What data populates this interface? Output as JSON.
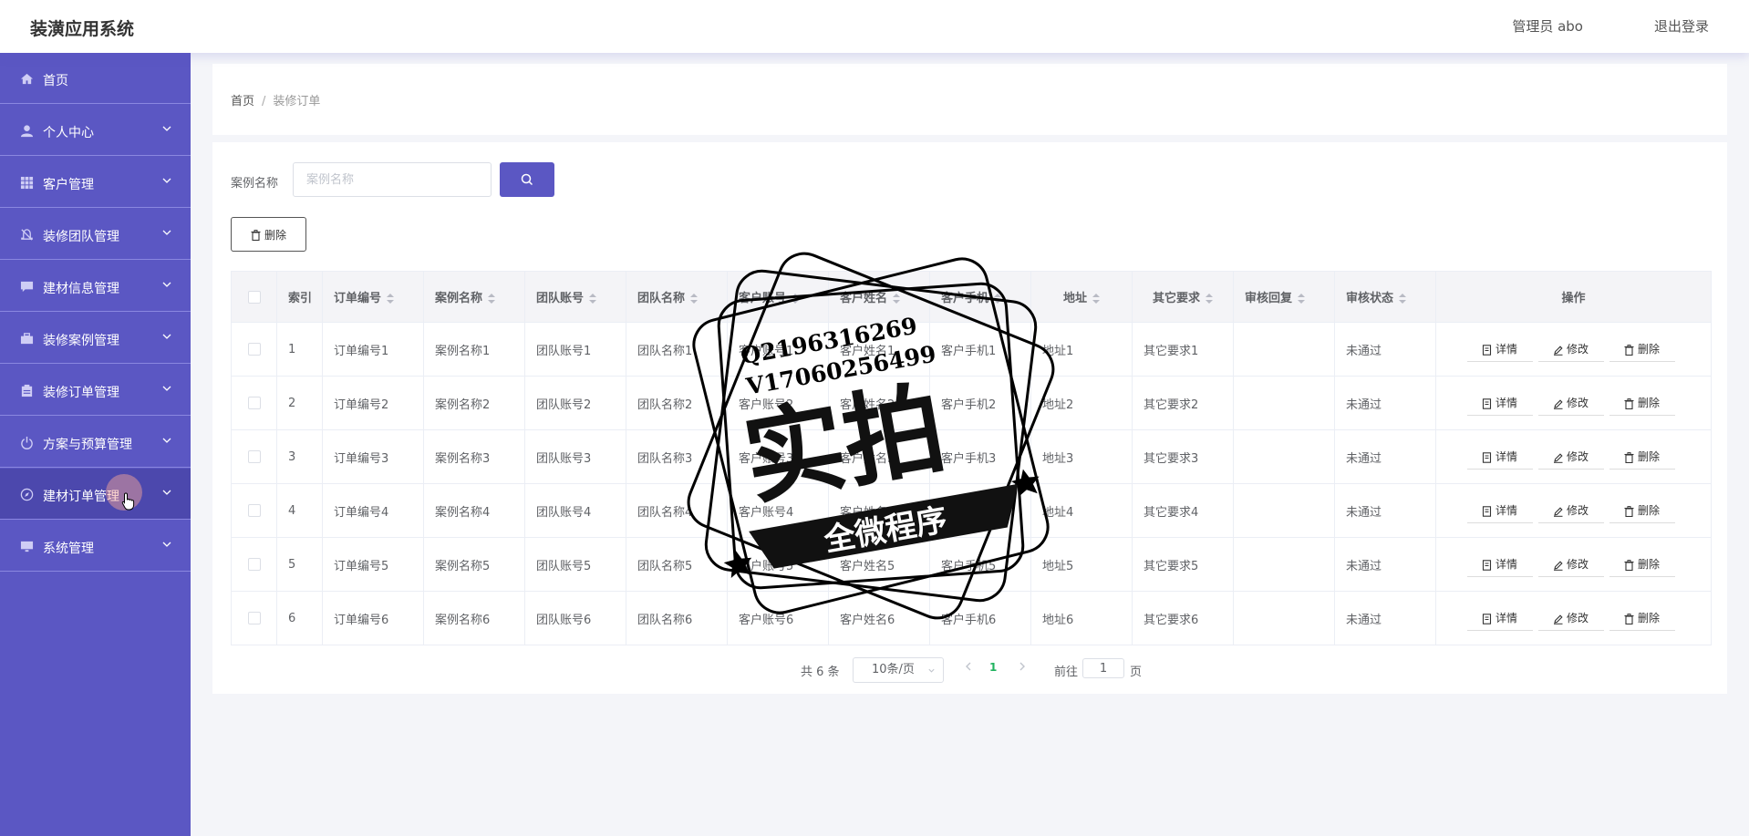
{
  "header": {
    "title": "装潢应用系统",
    "user": "管理员 abo",
    "logout": "退出登录"
  },
  "sidebar": {
    "items": [
      {
        "label": "首页",
        "icon": "home-icon"
      },
      {
        "label": "个人中心",
        "icon": "user-icon"
      },
      {
        "label": "客户管理",
        "icon": "grid-icon"
      },
      {
        "label": "装修团队管理",
        "icon": "bell-off-icon"
      },
      {
        "label": "建材信息管理",
        "icon": "chat-icon"
      },
      {
        "label": "装修案例管理",
        "icon": "briefcase-icon"
      },
      {
        "label": "装修订单管理",
        "icon": "clipboard-icon"
      },
      {
        "label": "方案与预算管理",
        "icon": "power-icon"
      },
      {
        "label": "建材订单管理",
        "icon": "compass-icon"
      },
      {
        "label": "系统管理",
        "icon": "monitor-icon"
      }
    ]
  },
  "breadcrumb": {
    "home": "首页",
    "separator": "/",
    "current": "装修订单"
  },
  "search": {
    "label": "案例名称",
    "placeholder": "案例名称",
    "value": ""
  },
  "toolbar": {
    "delete_label": "删除"
  },
  "table": {
    "columns": [
      "索引",
      "订单编号",
      "案例名称",
      "团队账号",
      "团队名称",
      "客户账号",
      "客户姓名",
      "客户手机",
      "地址",
      "其它要求",
      "审核回复",
      "审核状态",
      "操作"
    ],
    "rows": [
      [
        "1",
        "订单编号1",
        "案例名称1",
        "团队账号1",
        "团队名称1",
        "客户账号1",
        "客户姓名1",
        "客户手机1",
        "地址1",
        "其它要求1",
        "",
        "未通过"
      ],
      [
        "2",
        "订单编号2",
        "案例名称2",
        "团队账号2",
        "团队名称2",
        "客户账号2",
        "客户姓名2",
        "客户手机2",
        "地址2",
        "其它要求2",
        "",
        "未通过"
      ],
      [
        "3",
        "订单编号3",
        "案例名称3",
        "团队账号3",
        "团队名称3",
        "客户账号3",
        "客户姓名3",
        "客户手机3",
        "地址3",
        "其它要求3",
        "",
        "未通过"
      ],
      [
        "4",
        "订单编号4",
        "案例名称4",
        "团队账号4",
        "团队名称4",
        "客户账号4",
        "客户姓名4",
        "客户手机4",
        "地址4",
        "其它要求4",
        "",
        "未通过"
      ],
      [
        "5",
        "订单编号5",
        "案例名称5",
        "团队账号5",
        "团队名称5",
        "客户账号5",
        "客户姓名5",
        "客户手机5",
        "地址5",
        "其它要求5",
        "",
        "未通过"
      ],
      [
        "6",
        "订单编号6",
        "案例名称6",
        "团队账号6",
        "团队名称6",
        "客户账号6",
        "客户姓名6",
        "客户手机6",
        "地址6",
        "其它要求6",
        "",
        "未通过"
      ]
    ],
    "actions": {
      "detail": "详情",
      "edit": "修改",
      "delete": "删除"
    }
  },
  "pagination": {
    "total": "共 6 条",
    "page_size": "10条/页",
    "current_page": "1",
    "goto_label": "前往",
    "goto_value": "1",
    "page_suffix": "页"
  },
  "watermark": {
    "line1": "Q2196316269",
    "line2": "V17060256499",
    "main": "实拍",
    "ribbon": "全微程序"
  },
  "colors": {
    "sidebar": "#5b57c3",
    "accent": "#5b57c3",
    "active_page": "#21b35f"
  }
}
